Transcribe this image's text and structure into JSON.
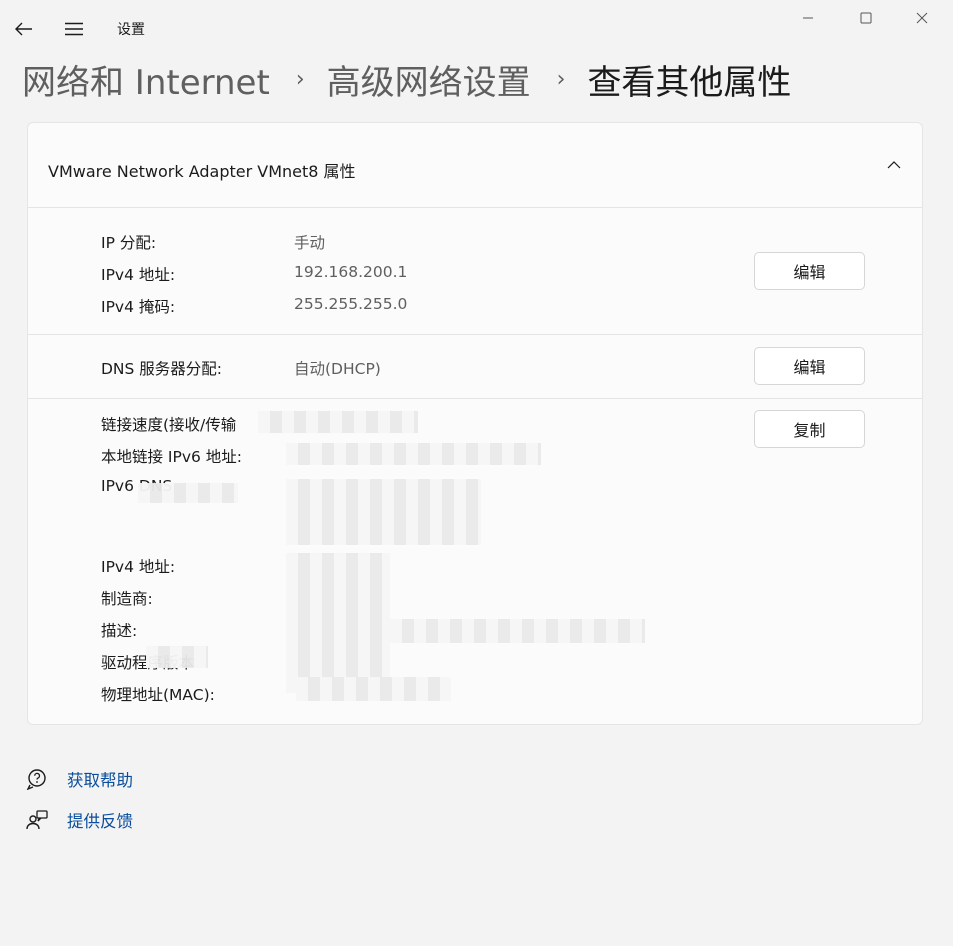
{
  "window": {
    "app_title": "设置",
    "back_icon": "back-arrow-icon",
    "menu_icon": "hamburger-menu-icon",
    "controls": [
      "minimize-icon",
      "maximize-icon",
      "close-icon"
    ]
  },
  "breadcrumb": {
    "items": [
      "网络和 Internet",
      "高级网络设置",
      "查看其他属性"
    ],
    "separator": "›"
  },
  "card": {
    "title": "VMware Network Adapter VMnet8 属性",
    "collapse_icon": "chevron-up-icon",
    "ip_section": {
      "rows": [
        {
          "label": "IP 分配:",
          "value": "手动"
        },
        {
          "label": "IPv4 地址:",
          "value": "192.168.200.1"
        },
        {
          "label": "IPv4 掩码:",
          "value": "255.255.255.0"
        }
      ],
      "edit_button": "编辑"
    },
    "dns_section": {
      "label": "DNS 服务器分配:",
      "value": "自动(DHCP)",
      "edit_button": "编辑"
    },
    "details_section": {
      "copy_button": "复制",
      "rows": [
        {
          "label": "链接速度(接收/传输",
          "value": ""
        },
        {
          "label": "本地链接 IPv6 地址:",
          "value": ""
        },
        {
          "label": "IPv6 DNS",
          "value": ""
        },
        {
          "label": "IPv4 地址:",
          "value": ""
        },
        {
          "label": "制造商:",
          "value": ""
        },
        {
          "label": "描述:",
          "value": ""
        },
        {
          "label": "驱动程序版本",
          "value": ""
        },
        {
          "label": "物理地址(MAC):",
          "value": ""
        }
      ]
    }
  },
  "links": [
    {
      "label": "获取帮助",
      "icon": "help-chat-icon"
    },
    {
      "label": "提供反馈",
      "icon": "feedback-icon"
    }
  ],
  "colors": {
    "background": "#f3f3f3",
    "card": "#fbfbfb",
    "link": "#0a4d9c",
    "secondary_text": "#5f5f5f"
  }
}
